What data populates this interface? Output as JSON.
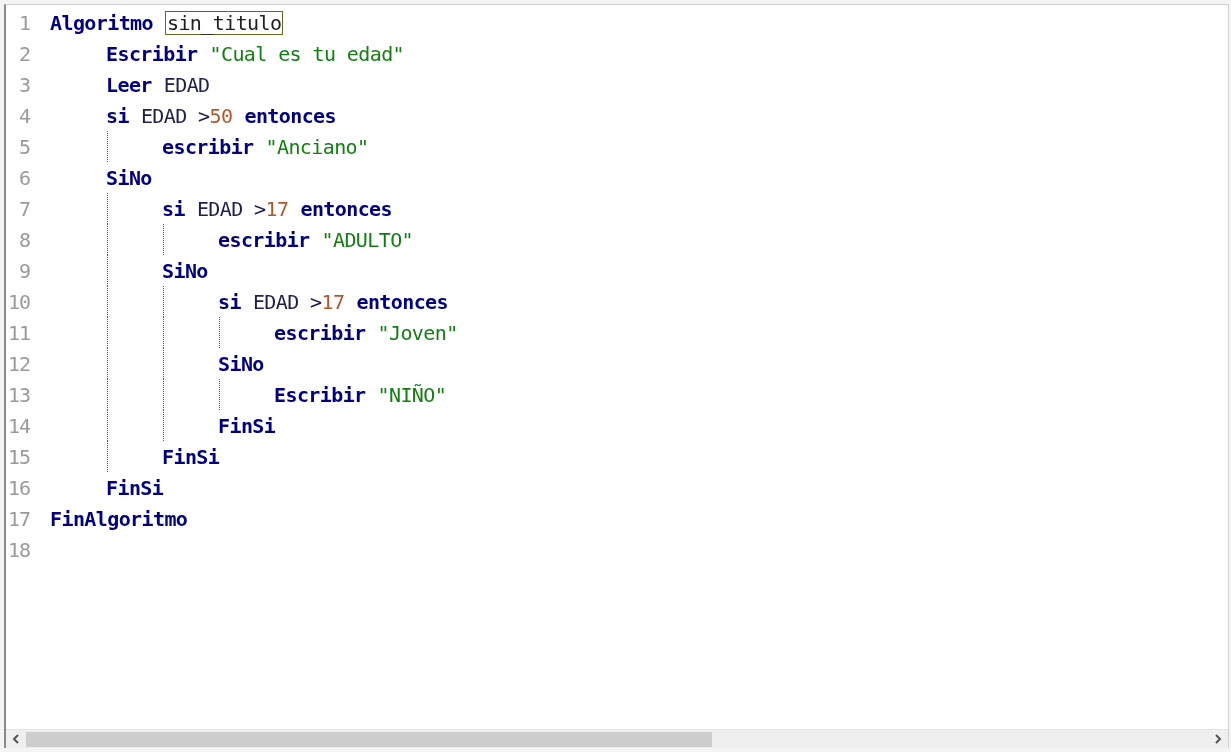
{
  "editor": {
    "lines": [
      {
        "number": "1",
        "tokens": [
          {
            "kind": "keyword",
            "text": "Algoritmo"
          },
          {
            "kind": "name",
            "text": "sin_titulo"
          }
        ],
        "guide": false,
        "children": [
          {
            "number": "2",
            "tokens": [
              {
                "kind": "keyword",
                "text": "Escribir"
              },
              {
                "kind": "string",
                "text": "\"Cual es tu edad\""
              }
            ]
          },
          {
            "number": "3",
            "tokens": [
              {
                "kind": "keyword",
                "text": "Leer"
              },
              {
                "kind": "plain",
                "text": "EDAD"
              }
            ]
          },
          {
            "number": "4",
            "tokens": [
              {
                "kind": "keyword",
                "text": "si"
              },
              {
                "kind": "plain",
                "text": "EDAD >"
              },
              {
                "kind": "number",
                "text": "50"
              },
              {
                "kind": "keyword",
                "text": "entonces"
              }
            ],
            "guide": true,
            "children": [
              {
                "number": "5",
                "tokens": [
                  {
                    "kind": "keyword",
                    "text": "escribir"
                  },
                  {
                    "kind": "string",
                    "text": "\"Anciano\""
                  }
                ]
              }
            ]
          },
          {
            "number": "6",
            "tokens": [
              {
                "kind": "keyword",
                "text": "SiNo"
              }
            ],
            "guide": true,
            "children": [
              {
                "number": "7",
                "tokens": [
                  {
                    "kind": "keyword",
                    "text": "si"
                  },
                  {
                    "kind": "plain",
                    "text": "EDAD >"
                  },
                  {
                    "kind": "number",
                    "text": "17"
                  },
                  {
                    "kind": "keyword",
                    "text": "entonces"
                  }
                ],
                "guide": true,
                "children": [
                  {
                    "number": "8",
                    "tokens": [
                      {
                        "kind": "keyword",
                        "text": "escribir"
                      },
                      {
                        "kind": "string",
                        "text": "\"ADULTO\""
                      }
                    ]
                  }
                ]
              },
              {
                "number": "9",
                "tokens": [
                  {
                    "kind": "keyword",
                    "text": "SiNo"
                  }
                ],
                "guide": true,
                "children": [
                  {
                    "number": "10",
                    "tokens": [
                      {
                        "kind": "keyword",
                        "text": "si"
                      },
                      {
                        "kind": "plain",
                        "text": "EDAD >"
                      },
                      {
                        "kind": "number",
                        "text": "17"
                      },
                      {
                        "kind": "keyword",
                        "text": "entonces"
                      }
                    ],
                    "guide": true,
                    "children": [
                      {
                        "number": "11",
                        "tokens": [
                          {
                            "kind": "keyword",
                            "text": "escribir"
                          },
                          {
                            "kind": "string",
                            "text": "\"Joven\""
                          }
                        ]
                      }
                    ]
                  },
                  {
                    "number": "12",
                    "tokens": [
                      {
                        "kind": "keyword",
                        "text": "SiNo"
                      }
                    ],
                    "guide": true,
                    "children": [
                      {
                        "number": "13",
                        "tokens": [
                          {
                            "kind": "keyword",
                            "text": "Escribir"
                          },
                          {
                            "kind": "string",
                            "text": "\"NIÑO\""
                          }
                        ]
                      }
                    ]
                  },
                  {
                    "number": "14",
                    "tokens": [
                      {
                        "kind": "keyword",
                        "text": "FinSi"
                      }
                    ]
                  }
                ]
              },
              {
                "number": "15",
                "tokens": [
                  {
                    "kind": "keyword",
                    "text": "FinSi"
                  }
                ]
              }
            ]
          },
          {
            "number": "16",
            "tokens": [
              {
                "kind": "keyword",
                "text": "FinSi"
              }
            ]
          }
        ]
      },
      {
        "number": "17",
        "tokens": [
          {
            "kind": "keyword",
            "text": "FinAlgoritmo"
          }
        ]
      },
      {
        "number": "18"
      }
    ]
  }
}
